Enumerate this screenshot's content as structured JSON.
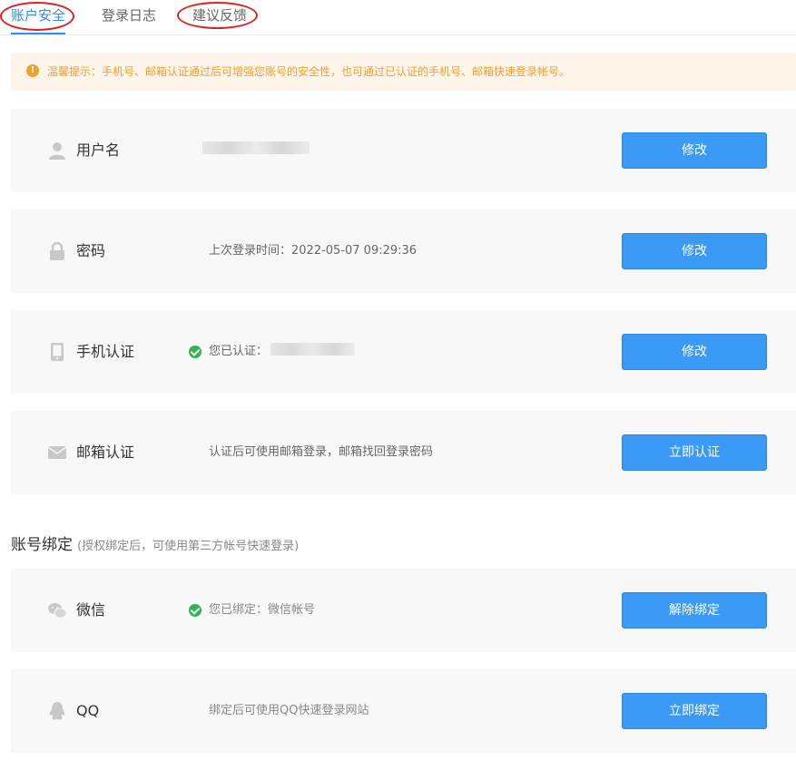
{
  "tabs": [
    {
      "label": "账户安全"
    },
    {
      "label": "登录日志"
    },
    {
      "label": "建议反馈"
    }
  ],
  "notice": {
    "icon": "warning-icon",
    "text": "温馨提示：手机号、邮箱认证通过后可增强您账号的安全性，也可通过已认证的手机号、邮箱快速登录帐号。"
  },
  "security": {
    "username": {
      "title": "用户名",
      "icon": "user-icon",
      "button": "修改"
    },
    "password": {
      "title": "密码",
      "icon": "lock-icon",
      "desc": "上次登录时间：2022-05-07 09:29:36",
      "button": "修改"
    },
    "phone": {
      "title": "手机认证",
      "icon": "phone-icon",
      "desc": "您已认证：",
      "button": "修改"
    },
    "email": {
      "title": "邮箱认证",
      "icon": "mail-icon",
      "desc": "认证后可使用邮箱登录，邮箱找回登录密码",
      "button": "立即认证"
    }
  },
  "binding": {
    "title": "账号绑定",
    "subtitle": "(授权绑定后，可使用第三方帐号快速登录)",
    "wechat": {
      "title": "微信",
      "icon": "wechat-icon",
      "desc": "您已绑定：微信帐号",
      "button": "解除绑定"
    },
    "qq": {
      "title": "QQ",
      "icon": "qq-icon",
      "desc": "绑定后可使用QQ快速登录网站",
      "button": "立即绑定"
    }
  },
  "colors": {
    "accent": "#2c8df4",
    "button": "#3a9af5",
    "warning": "#f0a030",
    "success": "#2fb455",
    "annotation": "#e02020"
  }
}
